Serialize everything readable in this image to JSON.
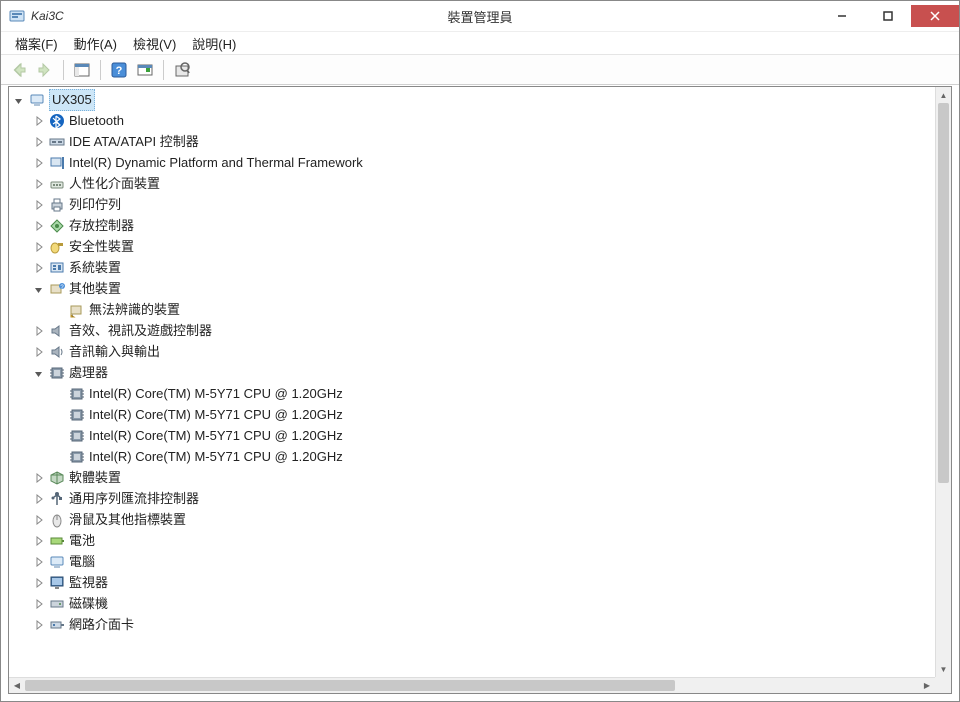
{
  "app": {
    "name": "Kai3C",
    "title": "裝置管理員"
  },
  "menus": {
    "file": "檔案(F)",
    "action": "動作(A)",
    "view": "檢視(V)",
    "help": "說明(H)"
  },
  "tree": {
    "root": "UX305",
    "items": [
      {
        "label": "Bluetooth",
        "iconName": "bluetooth-icon",
        "expanded": false
      },
      {
        "label": "IDE ATA/ATAPI 控制器",
        "iconName": "ide-controller-icon",
        "expanded": false
      },
      {
        "label": "Intel(R) Dynamic Platform and Thermal Framework",
        "iconName": "thermal-icon",
        "expanded": false
      },
      {
        "label": "人性化介面裝置",
        "iconName": "hid-icon",
        "expanded": false
      },
      {
        "label": "列印佇列",
        "iconName": "printer-icon",
        "expanded": false
      },
      {
        "label": "存放控制器",
        "iconName": "storage-controller-icon",
        "expanded": false
      },
      {
        "label": "安全性裝置",
        "iconName": "security-device-icon",
        "expanded": false
      },
      {
        "label": "系統裝置",
        "iconName": "system-device-icon",
        "expanded": false
      },
      {
        "label": "其他裝置",
        "iconName": "other-device-icon",
        "expanded": true,
        "children": [
          {
            "label": "無法辨識的裝置",
            "iconName": "unknown-device-icon"
          }
        ]
      },
      {
        "label": "音效、視訊及遊戲控制器",
        "iconName": "sound-controller-icon",
        "expanded": false
      },
      {
        "label": "音訊輸入與輸出",
        "iconName": "audio-io-icon",
        "expanded": false
      },
      {
        "label": "處理器",
        "iconName": "processor-icon",
        "expanded": true,
        "children": [
          {
            "label": "Intel(R) Core(TM) M-5Y71 CPU @ 1.20GHz",
            "iconName": "processor-icon"
          },
          {
            "label": "Intel(R) Core(TM) M-5Y71 CPU @ 1.20GHz",
            "iconName": "processor-icon"
          },
          {
            "label": "Intel(R) Core(TM) M-5Y71 CPU @ 1.20GHz",
            "iconName": "processor-icon"
          },
          {
            "label": "Intel(R) Core(TM) M-5Y71 CPU @ 1.20GHz",
            "iconName": "processor-icon"
          }
        ]
      },
      {
        "label": "軟體裝置",
        "iconName": "software-device-icon",
        "expanded": false
      },
      {
        "label": "通用序列匯流排控制器",
        "iconName": "usb-controller-icon",
        "expanded": false
      },
      {
        "label": "滑鼠及其他指標裝置",
        "iconName": "mouse-icon",
        "expanded": false
      },
      {
        "label": "電池",
        "iconName": "battery-icon",
        "expanded": false
      },
      {
        "label": "電腦",
        "iconName": "computer-icon",
        "expanded": false
      },
      {
        "label": "監視器",
        "iconName": "monitor-icon",
        "expanded": false
      },
      {
        "label": "磁碟機",
        "iconName": "disk-drive-icon",
        "expanded": false
      },
      {
        "label": "網路介面卡",
        "iconName": "network-adapter-icon",
        "expanded": false
      }
    ]
  }
}
